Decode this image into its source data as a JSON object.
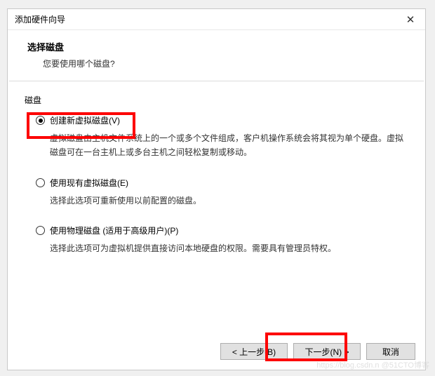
{
  "titlebar": {
    "title": "添加硬件向导"
  },
  "header": {
    "title": "选择磁盘",
    "subtitle": "您要使用哪个磁盘?"
  },
  "group": {
    "label": "磁盘"
  },
  "options": [
    {
      "label": "创建新虚拟磁盘(V)",
      "desc": "虚拟磁盘由主机文件系统上的一个或多个文件组成，客户机操作系统会将其视为单个硬盘。虚拟磁盘可在一台主机上或多台主机之间轻松复制或移动。",
      "checked": true
    },
    {
      "label": "使用现有虚拟磁盘(E)",
      "desc": "选择此选项可重新使用以前配置的磁盘。",
      "checked": false
    },
    {
      "label": "使用物理磁盘 (适用于高级用户)(P)",
      "desc": "选择此选项可为虚拟机提供直接访问本地硬盘的权限。需要具有管理员特权。",
      "checked": false
    }
  ],
  "buttons": {
    "back": "< 上一步(B)",
    "next": "下一步(N) >",
    "cancel": "取消"
  },
  "watermark": "https://blog.csdn.n @51CTO博客"
}
